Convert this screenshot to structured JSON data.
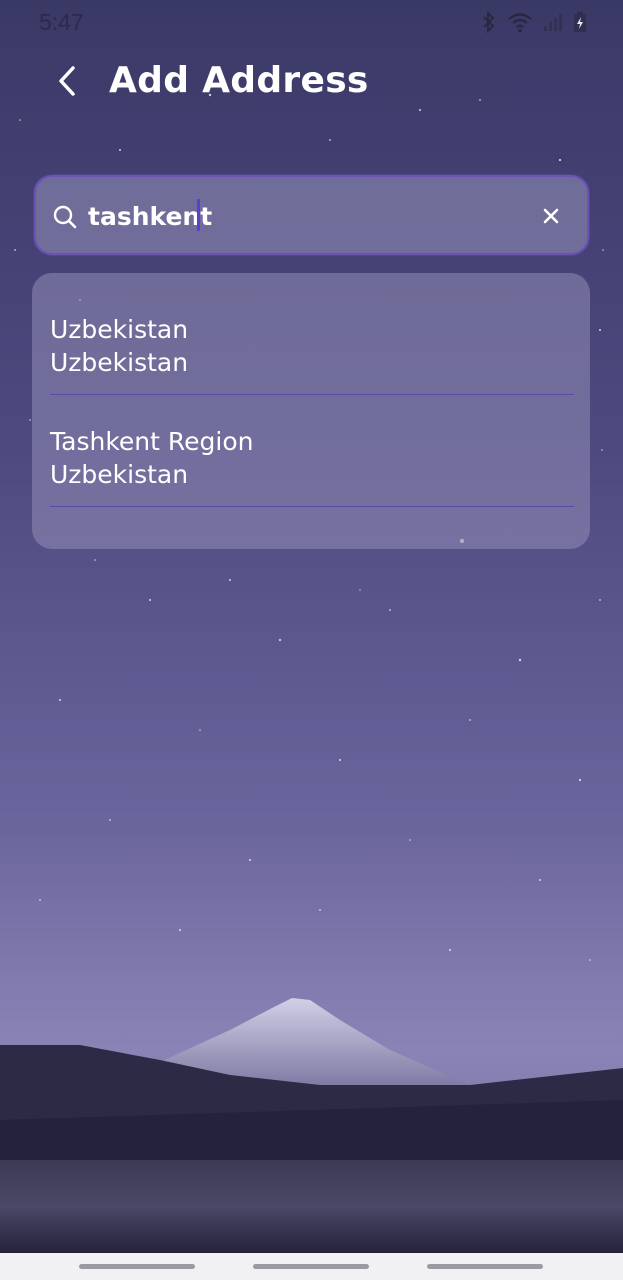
{
  "status_bar": {
    "time": "5:47",
    "icons": [
      "bluetooth-icon",
      "wifi-icon",
      "signal-icon",
      "battery-charging-icon"
    ]
  },
  "header": {
    "title": "Add Address",
    "back_icon": "chevron-left-icon"
  },
  "search": {
    "value": "tashkent",
    "placeholder": "",
    "search_icon": "search-icon",
    "clear_icon": "close-icon",
    "accent_color": "#6a52b8"
  },
  "results": [
    {
      "name": "Uzbekistan",
      "country": "Uzbekistan"
    },
    {
      "name": "Tashkent Region",
      "country": "Uzbekistan"
    }
  ],
  "background": {
    "sky_top": "#3b3a67",
    "sky_bottom": "#8a85b5",
    "mountain": "#b9b6d6"
  }
}
